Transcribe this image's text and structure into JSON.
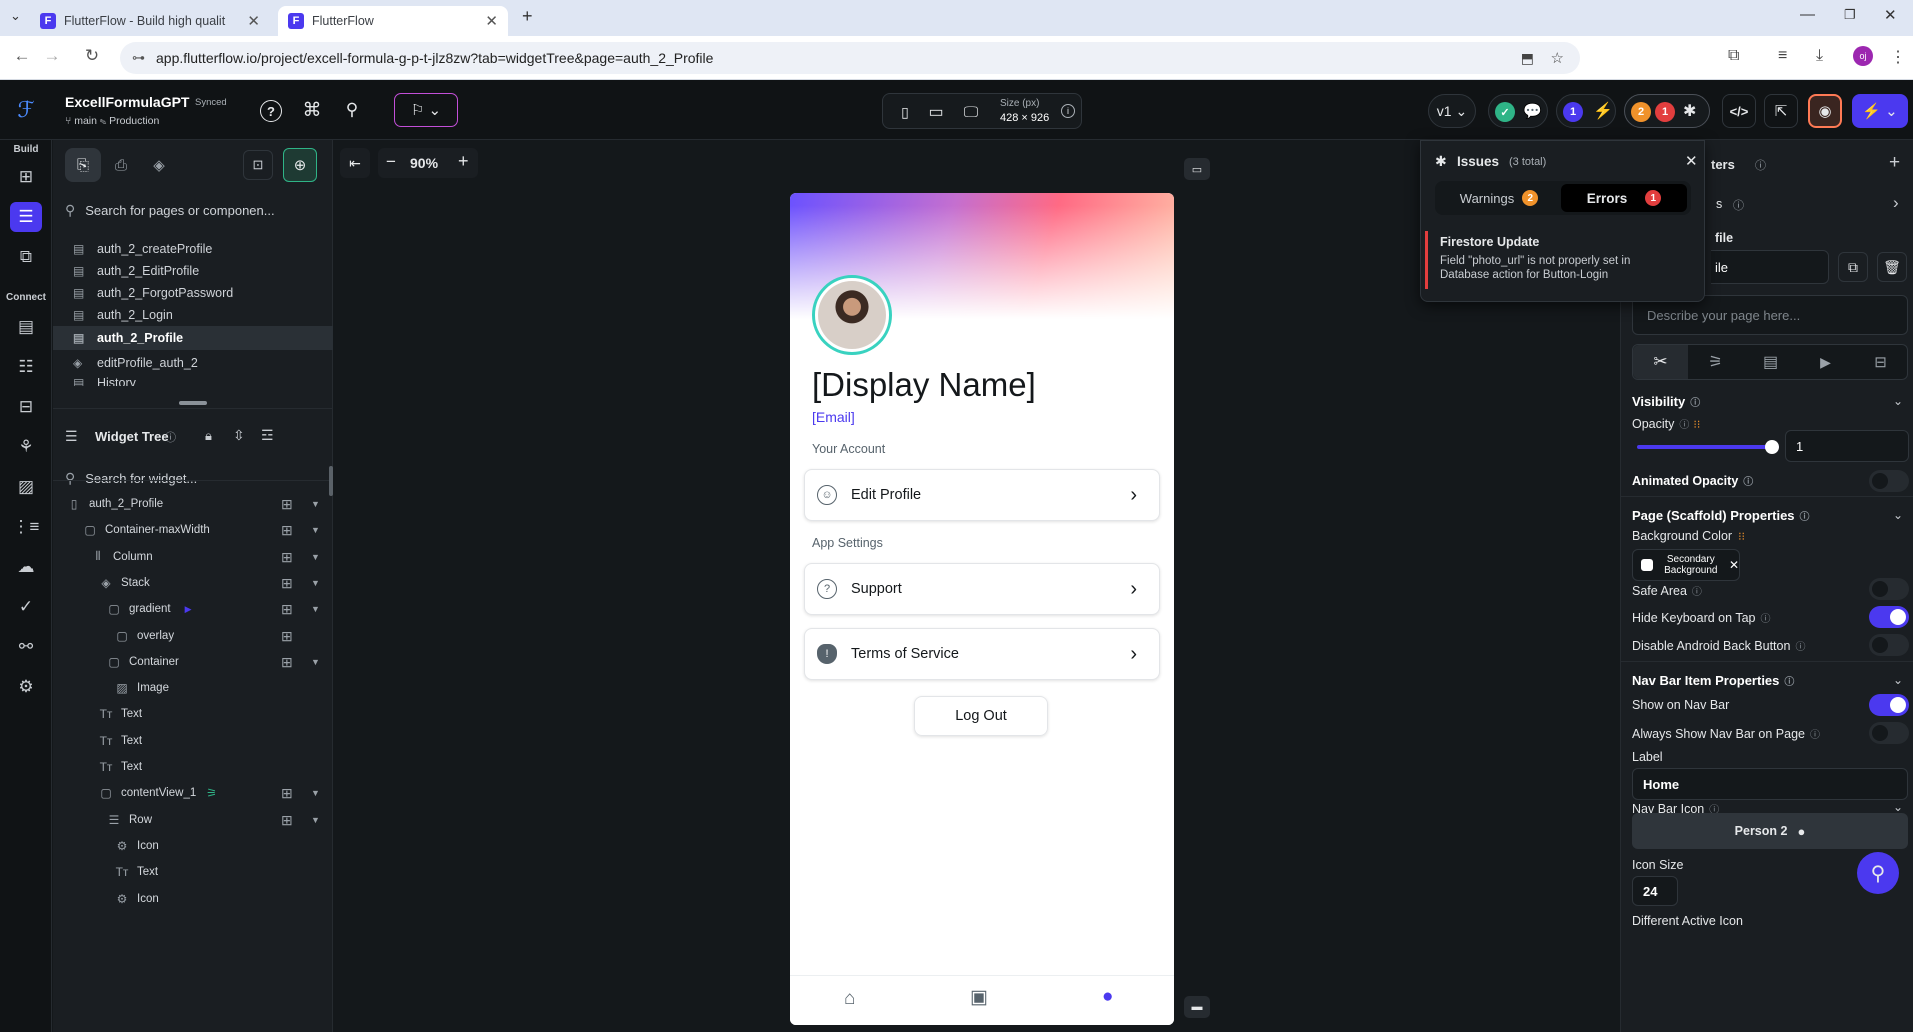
{
  "browser": {
    "tabs": [
      {
        "title": "FlutterFlow - Build high qualit",
        "active": false
      },
      {
        "title": "FlutterFlow",
        "active": true
      }
    ],
    "url": "app.flutterflow.io/project/excell-formula-g-p-t-jlz8zw?tab=widgetTree&page=auth_2_Profile"
  },
  "topbar": {
    "project_name": "ExcellFormulaGPT",
    "sync_status": "Synced",
    "branch": "main",
    "environment": "Production",
    "size_label": "Size (px)",
    "size_value": "428 × 926",
    "version": "v1",
    "issue_count_blue": "1",
    "warning_count": "2",
    "error_count": "1"
  },
  "rail": {
    "build_label": "Build",
    "connect_label": "Connect"
  },
  "left_panel": {
    "search_pages_placeholder": "Search for pages or componen...",
    "pages": [
      {
        "name": "auth_2_createProfile",
        "selected": false
      },
      {
        "name": "auth_2_EditProfile",
        "selected": false
      },
      {
        "name": "auth_2_ForgotPassword",
        "selected": false
      },
      {
        "name": "auth_2_Login",
        "selected": false
      },
      {
        "name": "auth_2_Profile",
        "selected": true
      },
      {
        "name": "editProfile_auth_2",
        "selected": false
      }
    ],
    "partial_item": "History",
    "widget_tree_title": "Widget Tree",
    "search_widget_placeholder": "Search for widget...",
    "tree": [
      {
        "label": "auth_2_Profile",
        "icon": "phone-icon"
      },
      {
        "label": "Container-maxWidth",
        "icon": "container-icon"
      },
      {
        "label": "Column",
        "icon": "column-icon"
      },
      {
        "label": "Stack",
        "icon": "stack-icon"
      },
      {
        "label": "gradient",
        "icon": "container-icon"
      },
      {
        "label": "overlay",
        "icon": "container-icon"
      },
      {
        "label": "Container",
        "icon": "container-icon"
      },
      {
        "label": "Image",
        "icon": "image-icon"
      },
      {
        "label": "Text",
        "icon": "text-icon"
      },
      {
        "label": "Text",
        "icon": "text-icon"
      },
      {
        "label": "Text",
        "icon": "text-icon"
      },
      {
        "label": "contentView_1",
        "icon": "container-icon"
      },
      {
        "label": "Row",
        "icon": "row-icon"
      },
      {
        "label": "Icon",
        "icon": "gear-icon"
      },
      {
        "label": "Text",
        "icon": "text-icon"
      },
      {
        "label": "Icon",
        "icon": "gear-icon"
      }
    ]
  },
  "canvas": {
    "zoom": "90%",
    "phone": {
      "display_name": "[Display Name]",
      "email": "[Email]",
      "your_account_label": "Your Account",
      "edit_profile": "Edit Profile",
      "app_settings_label": "App Settings",
      "support": "Support",
      "terms": "Terms of Service",
      "logout": "Log Out"
    }
  },
  "issues": {
    "title": "Issues",
    "total": "(3 total)",
    "warnings_label": "Warnings",
    "warnings_count": "2",
    "errors_label": "Errors",
    "errors_count": "1",
    "item_title": "Firestore Update",
    "item_desc": "Field \"photo_url\" is not properly set in Database action for Button-Login"
  },
  "right_panel": {
    "header_partial": "ters",
    "row2_partial": "s",
    "page_name_partial_label": "file",
    "page_name_partial_value": "ile",
    "describe_placeholder": "Describe your page here...",
    "visibility": "Visibility",
    "opacity": "Opacity",
    "opacity_value": "1",
    "opacity_level": 1,
    "animated_opacity": "Animated Opacity",
    "scaffold": "Page (Scaffold) Properties",
    "background_color": "Background Color",
    "bg_value": "Secondary Background",
    "safe_area": "Safe Area",
    "hide_keyboard": "Hide Keyboard on Tap",
    "disable_back": "Disable Android Back Button",
    "nav_bar_props": "Nav Bar Item Properties",
    "show_on_nav": "Show on Nav Bar",
    "always_show": "Always Show Nav Bar on Page",
    "label": "Label",
    "label_value": "Home",
    "nav_bar_icon": "Nav Bar Icon",
    "icon_value": "Person 2",
    "icon_size": "Icon Size",
    "icon_size_value": "24",
    "different_active": "Different Active Icon"
  },
  "colors": {
    "accent": "#4b39ef",
    "warning": "#f0922b",
    "error": "#e23e3e",
    "success": "#2fb487"
  }
}
